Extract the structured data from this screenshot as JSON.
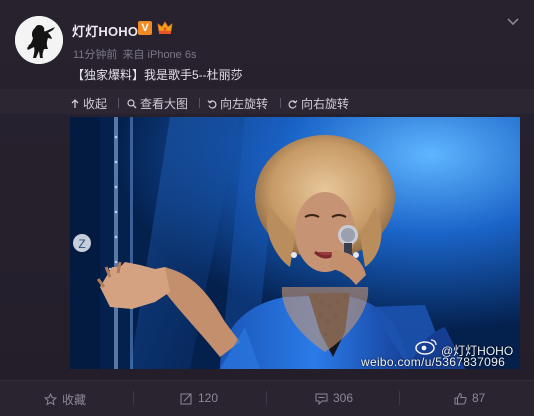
{
  "post": {
    "username": "灯灯HOHO",
    "verified_badge": "V",
    "meta_time": "11分钟前",
    "meta_source": "来自 iPhone 6s",
    "text": "【独家爆料】我是歌手5--杜丽莎"
  },
  "toolbar": {
    "collapse": "收起",
    "view_large": "查看大图",
    "rotate_left": "向左旋转",
    "rotate_right": "向右旋转"
  },
  "photo": {
    "watermark_handle": "@灯灯HOHO",
    "watermark_url": "weibo.com/u/5367837096"
  },
  "footer": {
    "favorite": "收藏",
    "repost_count": "120",
    "comment_count": "306",
    "like_count": "87"
  },
  "colors": {
    "background": "#25202c",
    "verified_orange": "#f08a24",
    "stage_blue": "#1f6fe0"
  },
  "icons": [
    "avatar-figure",
    "crown-icon",
    "chevron-down-icon",
    "collapse-icon",
    "zoom-icon",
    "rotate-left-icon",
    "rotate-right-icon",
    "weibo-logo-icon",
    "star-icon",
    "repost-icon",
    "comment-icon",
    "like-icon"
  ]
}
